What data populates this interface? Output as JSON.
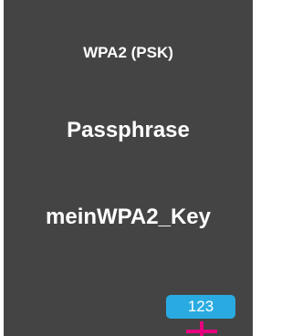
{
  "screen": {
    "security_type": "WPA2 (PSK)",
    "field_label": "Passphrase",
    "field_value": "meinWPA2_Key"
  },
  "input_mode": {
    "label": "123"
  },
  "icons": {
    "cursor": "text-cursor-icon"
  },
  "colors": {
    "panel_background": "#444444",
    "text": "#ffffff",
    "mode_badge": "#29abe2",
    "cursor": "#e6007e"
  }
}
